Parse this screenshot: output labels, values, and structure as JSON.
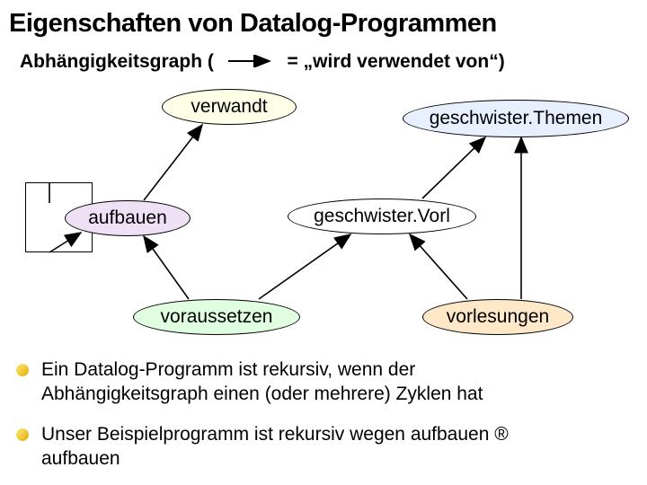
{
  "title": "Eigenschaften von Datalog-Programmen",
  "subtitle_left": "Abhängigkeitsgraph (",
  "subtitle_right": "= „wird verwendet von“)",
  "nodes": {
    "verwandt": "verwandt",
    "geschwisterThemen": "geschwister.Themen",
    "aufbauen": "aufbauen",
    "geschwisterVorl": "geschwister.Vorl",
    "voraussetzen": "voraussetzen",
    "vorlesungen": "vorlesungen"
  },
  "bullet1_a": "Ein Datalog-Programm ist rekursiv, wenn der",
  "bullet1_b": "Abhängigkeitsgraph einen (oder mehrere) Zyklen hat",
  "bullet2_a": "Unser Beispielprogramm ist rekursiv wegen aufbauen ",
  "bullet2_b": "aufbauen",
  "implies": "®",
  "colors": {
    "verwandt": "#ffffe8",
    "geschwisterThemen": "#e8f0ff",
    "aufbauen": "#eee0f5",
    "geschwisterVorl": "#ffffff",
    "voraussetzen": "#e0ffe0",
    "vorlesungen": "#ffe8c8"
  },
  "chart_data": {
    "type": "graph",
    "title": "Abhängigkeitsgraph (= „wird verwendet von“)",
    "nodes": [
      "verwandt",
      "geschwister.Themen",
      "aufbauen",
      "geschwister.Vorl",
      "voraussetzen",
      "vorlesungen"
    ],
    "edges": [
      {
        "from": "aufbauen",
        "to": "verwandt"
      },
      {
        "from": "aufbauen",
        "to": "aufbauen"
      },
      {
        "from": "voraussetzen",
        "to": "aufbauen"
      },
      {
        "from": "voraussetzen",
        "to": "geschwister.Vorl"
      },
      {
        "from": "vorlesungen",
        "to": "geschwister.Vorl"
      },
      {
        "from": "vorlesungen",
        "to": "geschwister.Themen"
      },
      {
        "from": "geschwister.Vorl",
        "to": "geschwister.Themen"
      }
    ]
  }
}
